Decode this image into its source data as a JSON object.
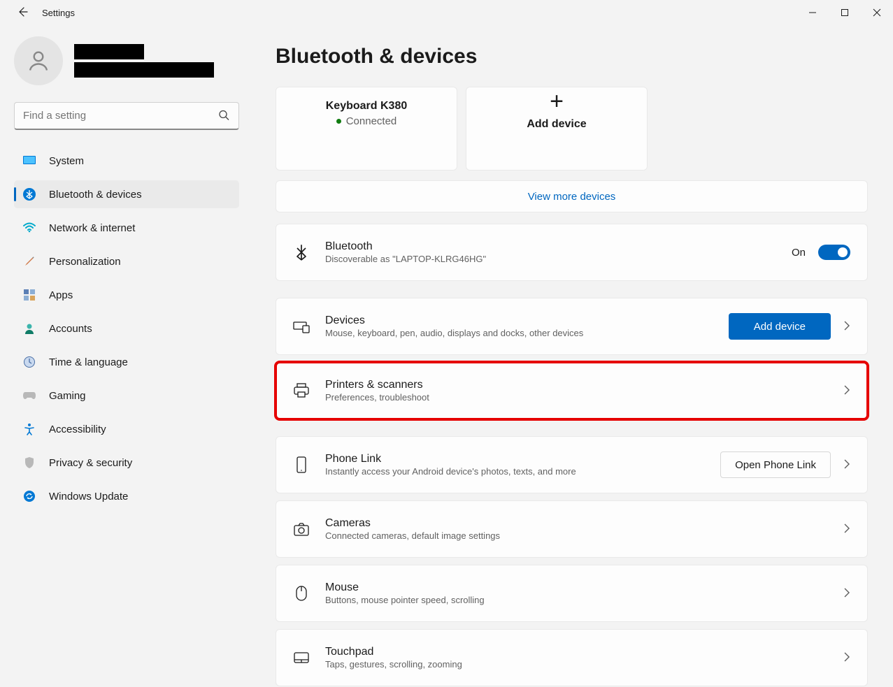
{
  "window": {
    "title": "Settings"
  },
  "search": {
    "placeholder": "Find a setting"
  },
  "nav": {
    "items": [
      {
        "label": "System"
      },
      {
        "label": "Bluetooth & devices"
      },
      {
        "label": "Network & internet"
      },
      {
        "label": "Personalization"
      },
      {
        "label": "Apps"
      },
      {
        "label": "Accounts"
      },
      {
        "label": "Time & language"
      },
      {
        "label": "Gaming"
      },
      {
        "label": "Accessibility"
      },
      {
        "label": "Privacy & security"
      },
      {
        "label": "Windows Update"
      }
    ]
  },
  "page": {
    "title": "Bluetooth & devices"
  },
  "deviceCards": {
    "connected": {
      "name": "Keyboard K380",
      "status": "Connected"
    },
    "add": {
      "label": "Add device"
    }
  },
  "viewMore": {
    "label": "View more devices"
  },
  "bluetooth": {
    "title": "Bluetooth",
    "sub": "Discoverable as \"LAPTOP-KLRG46HG\"",
    "state": "On"
  },
  "rows": {
    "devices": {
      "title": "Devices",
      "sub": "Mouse, keyboard, pen, audio, displays and docks, other devices",
      "button": "Add device"
    },
    "printers": {
      "title": "Printers & scanners",
      "sub": "Preferences, troubleshoot"
    },
    "phone": {
      "title": "Phone Link",
      "sub": "Instantly access your Android device's photos, texts, and more",
      "button": "Open Phone Link"
    },
    "cameras": {
      "title": "Cameras",
      "sub": "Connected cameras, default image settings"
    },
    "mouse": {
      "title": "Mouse",
      "sub": "Buttons, mouse pointer speed, scrolling"
    },
    "touchpad": {
      "title": "Touchpad",
      "sub": "Taps, gestures, scrolling, zooming"
    }
  }
}
